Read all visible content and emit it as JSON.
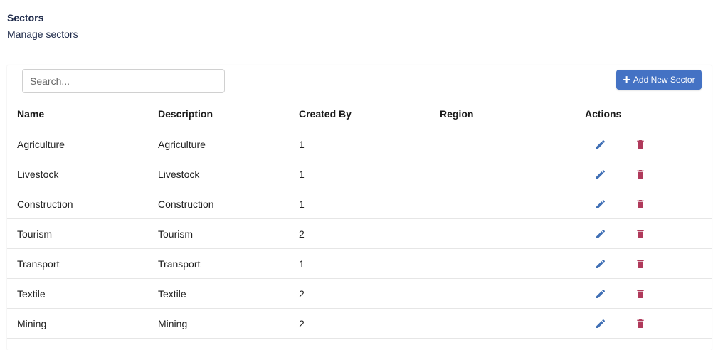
{
  "page": {
    "title": "Sectors",
    "subtitle": "Manage sectors"
  },
  "search": {
    "placeholder": "Search...",
    "value": ""
  },
  "toolbar": {
    "add_label": "Add New Sector",
    "add_icon": "plus-icon"
  },
  "table": {
    "headers": {
      "name": "Name",
      "description": "Description",
      "created_by": "Created By",
      "region": "Region",
      "actions": "Actions"
    },
    "rows": [
      {
        "name": "Agriculture",
        "description": "Agriculture",
        "created_by": "1",
        "region": ""
      },
      {
        "name": "Livestock",
        "description": "Livestock",
        "created_by": "1",
        "region": ""
      },
      {
        "name": "Construction",
        "description": "Construction",
        "created_by": "1",
        "region": ""
      },
      {
        "name": "Tourism",
        "description": "Tourism",
        "created_by": "2",
        "region": ""
      },
      {
        "name": "Transport",
        "description": "Transport",
        "created_by": "1",
        "region": ""
      },
      {
        "name": "Textile",
        "description": "Textile",
        "created_by": "2",
        "region": ""
      },
      {
        "name": "Mining",
        "description": "Mining",
        "created_by": "2",
        "region": ""
      }
    ],
    "row_actions": {
      "edit_icon": "pencil-icon",
      "delete_icon": "trash-icon"
    }
  },
  "colors": {
    "primary": "#4472c4",
    "edit": "#3f6fb5",
    "delete": "#b03a5b",
    "title": "#1e2a4a"
  }
}
